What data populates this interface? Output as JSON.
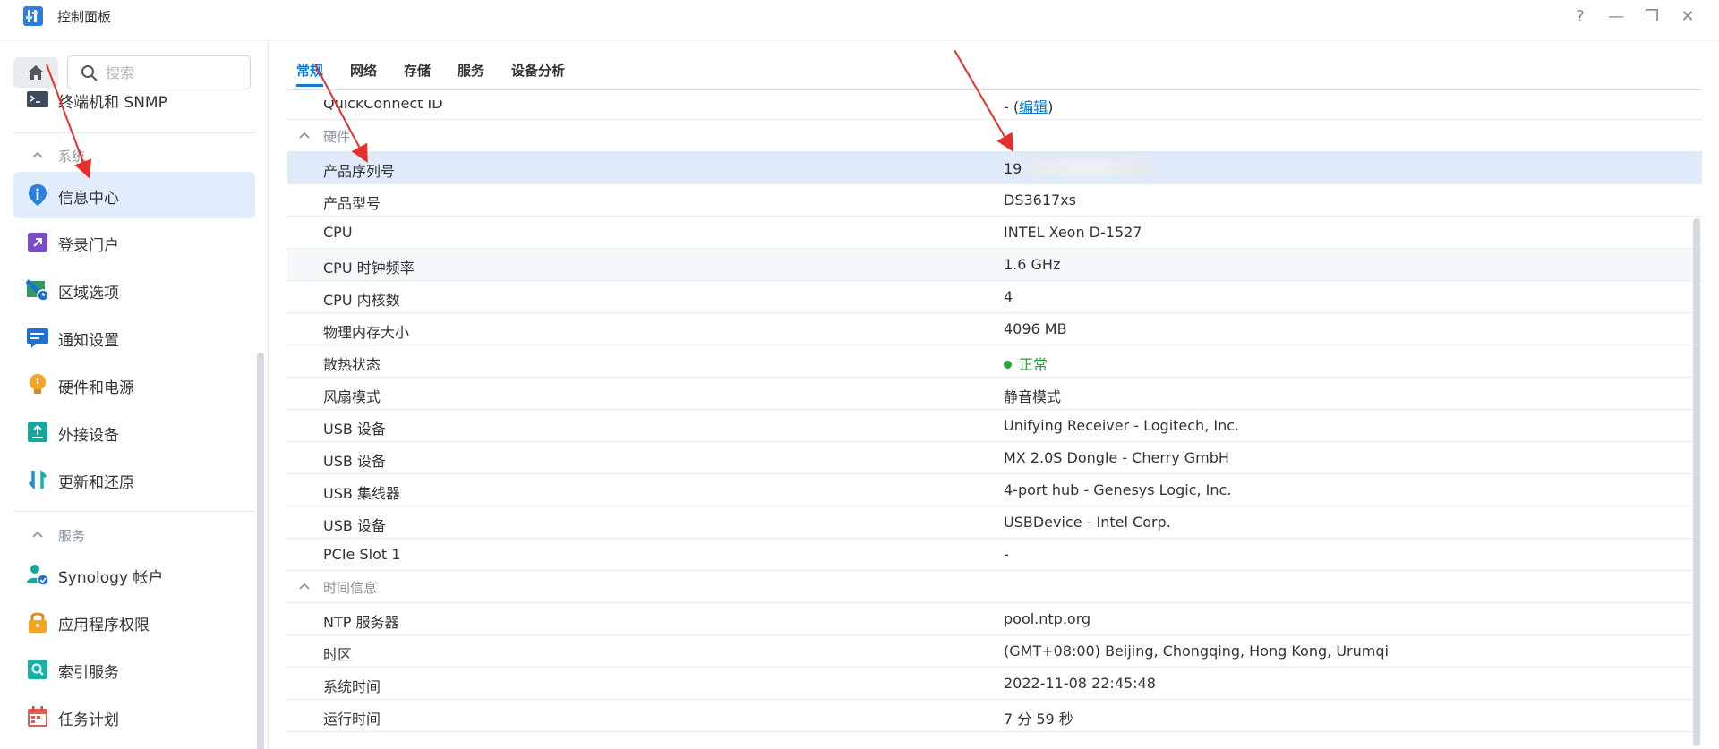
{
  "window": {
    "title": "控制面板",
    "controls": {
      "help": "?",
      "minimize": "—",
      "restore": "❐",
      "close": "✕"
    }
  },
  "sidebar": {
    "search_placeholder": "搜索",
    "partial_item": {
      "label": "终端机和 SNMP",
      "icon": "terminal-icon"
    },
    "sections": [
      {
        "label": "系统",
        "items": [
          {
            "label": "信息中心",
            "icon": "info-icon",
            "active": true
          },
          {
            "label": "登录门户",
            "icon": "portal-icon"
          },
          {
            "label": "区域选项",
            "icon": "region-icon"
          },
          {
            "label": "通知设置",
            "icon": "notification-icon"
          },
          {
            "label": "硬件和电源",
            "icon": "bulb-icon"
          },
          {
            "label": "外接设备",
            "icon": "external-device-icon"
          },
          {
            "label": "更新和还原",
            "icon": "update-icon"
          }
        ]
      },
      {
        "label": "服务",
        "items": [
          {
            "label": "Synology 帐户",
            "icon": "account-icon"
          },
          {
            "label": "应用程序权限",
            "icon": "lock-icon"
          },
          {
            "label": "索引服务",
            "icon": "index-icon"
          },
          {
            "label": "任务计划",
            "icon": "calendar-icon"
          }
        ]
      }
    ]
  },
  "tabs": [
    {
      "label": "常规",
      "active": true
    },
    {
      "label": "网络"
    },
    {
      "label": "存储"
    },
    {
      "label": "服务"
    },
    {
      "label": "设备分析"
    }
  ],
  "table": {
    "quickconnect": {
      "key": "QuickConnect ID",
      "value_prefix": "- (",
      "link": "编辑",
      "value_suffix": ")"
    },
    "hardware_group": "硬件",
    "hardware_rows": [
      {
        "key": "产品序列号",
        "value": "19"
      },
      {
        "key": "产品型号",
        "value": "DS3617xs"
      },
      {
        "key": "CPU",
        "value": "INTEL Xeon D-1527"
      },
      {
        "key": "CPU 时钟频率",
        "value": "1.6 GHz"
      },
      {
        "key": "CPU 内核数",
        "value": "4"
      },
      {
        "key": "物理内存大小",
        "value": "4096 MB"
      },
      {
        "key": "散热状态",
        "value": "正常"
      },
      {
        "key": "风扇模式",
        "value": "静音模式"
      },
      {
        "key": "USB 设备",
        "value": "Unifying Receiver - Logitech, Inc."
      },
      {
        "key": "USB 设备",
        "value": "MX 2.0S Dongle - Cherry GmbH"
      },
      {
        "key": "USB 集线器",
        "value": "4-port hub - Genesys Logic, Inc."
      },
      {
        "key": "USB 设备",
        "value": "USBDevice - Intel Corp."
      },
      {
        "key": "PCIe Slot 1",
        "value": "-"
      }
    ],
    "time_group": "时间信息",
    "time_rows": [
      {
        "key": "NTP 服务器",
        "value": "pool.ntp.org"
      },
      {
        "key": "时区",
        "value": "(GMT+08:00) Beijing, Chongqing, Hong Kong, Urumqi"
      },
      {
        "key": "系统时间",
        "value": "2022-11-08 22:45:48"
      },
      {
        "key": "运行时间",
        "value": "7 分 59 秒"
      }
    ]
  },
  "colors": {
    "accent": "#0b7bdc",
    "ok": "#2a9d39",
    "arrow": "#e5302e"
  }
}
